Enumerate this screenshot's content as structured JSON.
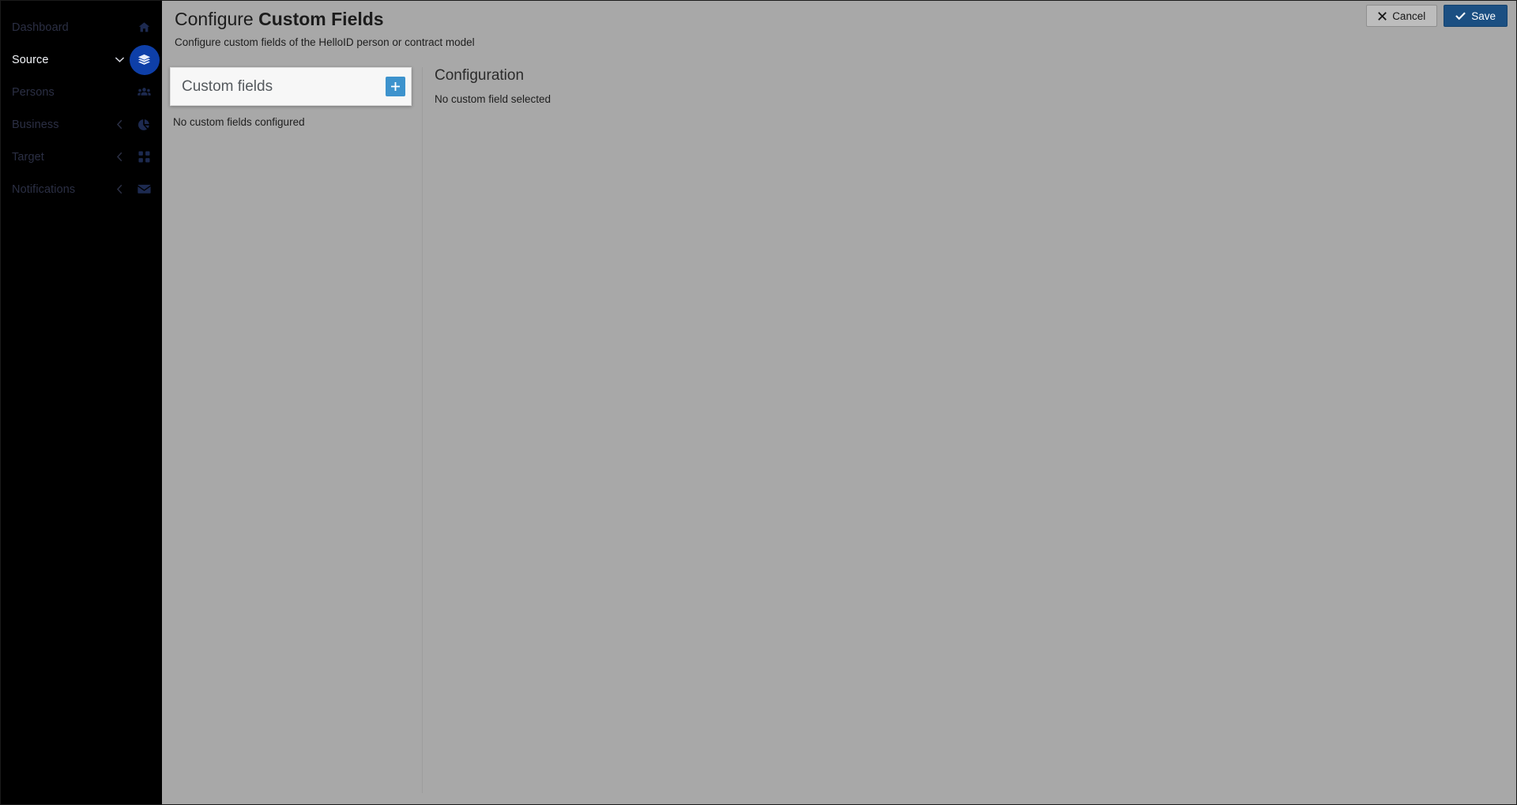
{
  "sidebar": {
    "items": [
      {
        "label": "Dashboard",
        "icon": "home-icon",
        "active": false,
        "caret": "none"
      },
      {
        "label": "Source",
        "icon": "layers-icon",
        "active": true,
        "caret": "chevron-down"
      },
      {
        "label": "Persons",
        "icon": "users-icon",
        "active": false,
        "caret": "none"
      },
      {
        "label": "Business",
        "icon": "pie-chart-icon",
        "active": false,
        "caret": "chevron-left"
      },
      {
        "label": "Target",
        "icon": "grid-squares-icon",
        "active": false,
        "caret": "chevron-left"
      },
      {
        "label": "Notifications",
        "icon": "envelope-icon",
        "active": false,
        "caret": "chevron-left"
      }
    ]
  },
  "header": {
    "title_prefix": "Configure ",
    "title_strong": "Custom Fields",
    "subtitle": "Configure custom fields of the HelloID person or contract model",
    "cancel_label": "Cancel",
    "save_label": "Save",
    "cancel_icon": "cross-icon",
    "save_icon": "check-icon"
  },
  "custom_fields_panel": {
    "title": "Custom fields",
    "add_icon": "plus-icon",
    "empty_text": "No custom fields configured",
    "items": []
  },
  "configuration_panel": {
    "title": "Configuration",
    "empty_text": "No custom field selected"
  },
  "colors": {
    "page_background": "#a8a8a8",
    "sidebar_background": "#000000",
    "sidebar_active_bubble": "#0e3fa8",
    "sidebar_inactive_text": "#2b2f44",
    "sidebar_active_text": "#f2f4f8",
    "save_button": "#1b4f82",
    "cancel_button": "#bdbdbd",
    "add_button": "#3d93cd",
    "card_background": "#f7f7f7"
  }
}
